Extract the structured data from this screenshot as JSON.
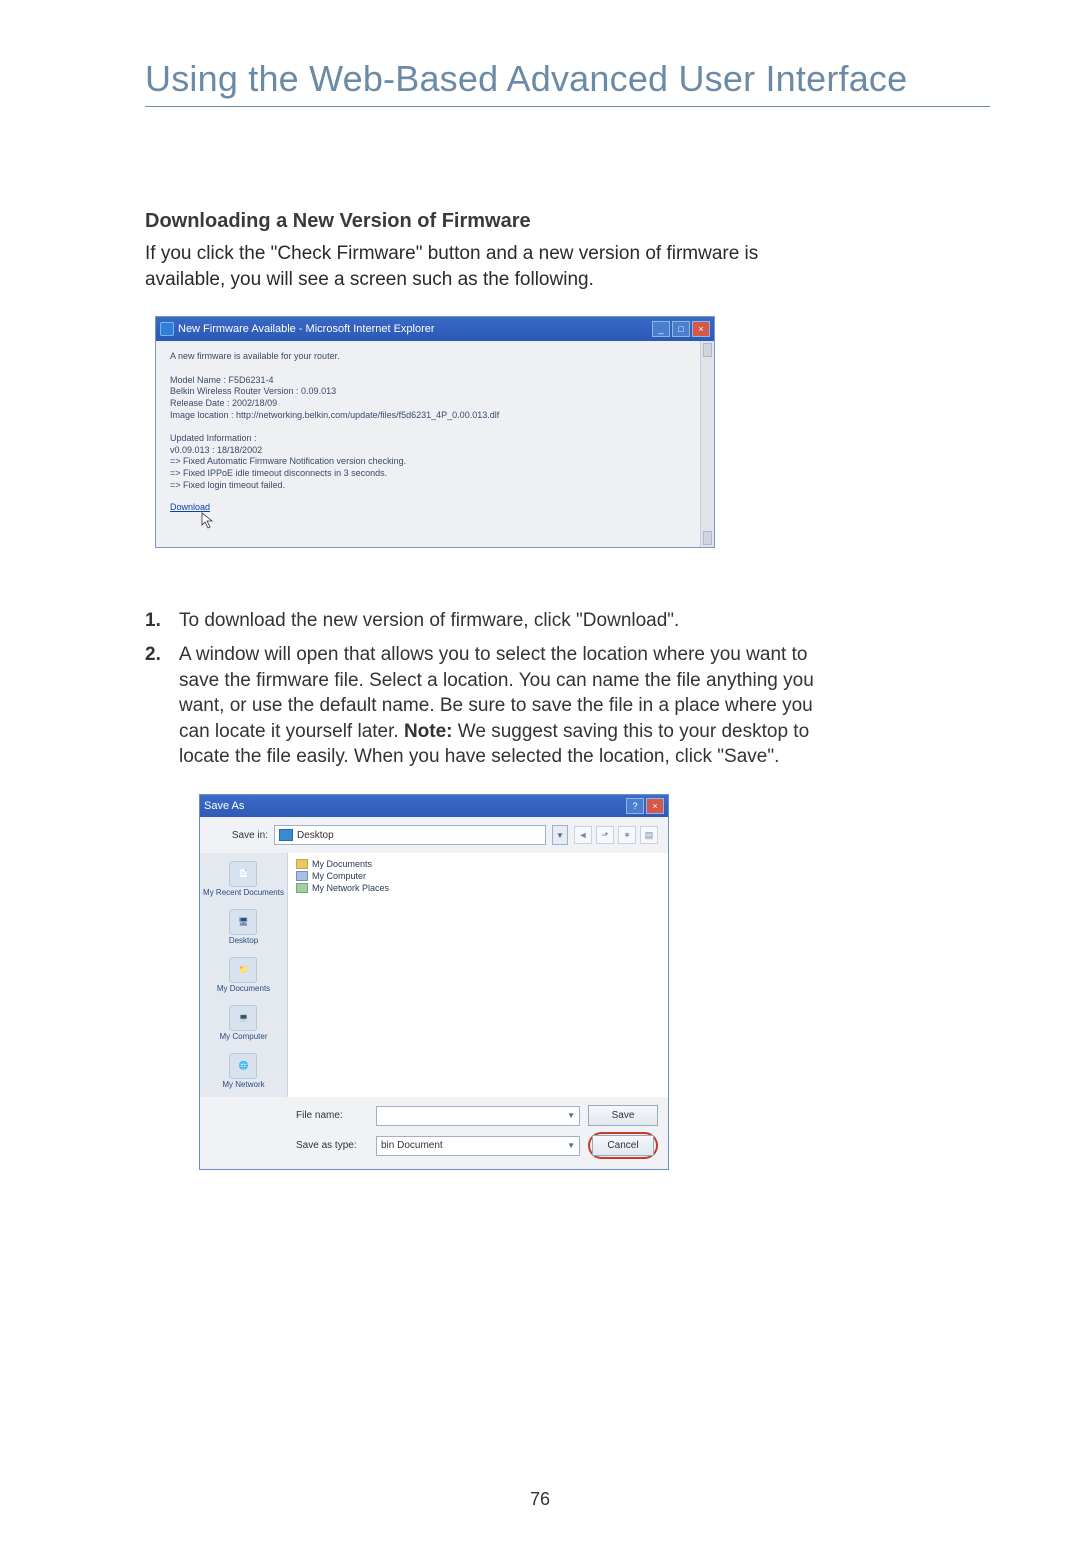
{
  "page_title": "Using the Web-Based Advanced User Interface",
  "section_heading": "Downloading a New Version of Firmware",
  "intro_text": "If you click the \"Check Firmware\" button and a new version of firmware is available, you will see a screen such as the following.",
  "browser": {
    "title": "New Firmware Available - Microsoft Internet Explorer",
    "line_intro": "A new firmware is available for your router.",
    "model_label": "Model Name : F5D6231-4",
    "belkin_line": "Belkin Wireless Router Version : 0.09.013",
    "release_date": "Release Date : 2002/18/09",
    "image_location": "Image location : http://networking.belkin.com/update/files/f5d6231_4P_0.00.013.dlf",
    "updated_info": "Updated Information :",
    "v_line": "v0.09.013 : 18/18/2002",
    "fixed1": "=> Fixed Automatic Firmware Notification version checking.",
    "fixed2": "=> Fixed IPPoE idle timeout disconnects in 3 seconds.",
    "fixed3": "=> Fixed login timeout failed.",
    "download": "Download"
  },
  "steps": [
    {
      "num": "1.",
      "text": "To download the new version of firmware, click \"Download\"."
    },
    {
      "num": "2.",
      "text_before_note": "A window will open that allows you to select the location where you want to save the firmware file. Select a location. You can name the file anything you want, or use the default name. Be sure to save the file in a place where you can locate it yourself later. ",
      "note_label": "Note:",
      "text_after_note": " We suggest saving this to your desktop to locate the file easily. When you have selected the location, click \"Save\"."
    }
  ],
  "saveas": {
    "title": "Save As",
    "save_in_label": "Save in:",
    "save_in_value": "Desktop",
    "toolbar_icons": [
      "back-icon",
      "up-icon",
      "new-folder-icon",
      "views-icon"
    ],
    "places": [
      {
        "name": "My Recent Documents"
      },
      {
        "name": "Desktop"
      },
      {
        "name": "My Documents"
      },
      {
        "name": "My Computer"
      },
      {
        "name": "My Network"
      }
    ],
    "files": [
      {
        "icon": "folder",
        "label": "My Documents"
      },
      {
        "icon": "computer",
        "label": "My Computer"
      },
      {
        "icon": "network",
        "label": "My Network Places"
      }
    ],
    "filename_label": "File name:",
    "filename_value": "",
    "saveastype_label": "Save as type:",
    "saveastype_value": "bin Document",
    "save_btn": "Save",
    "cancel_btn": "Cancel"
  },
  "page_number": "76"
}
